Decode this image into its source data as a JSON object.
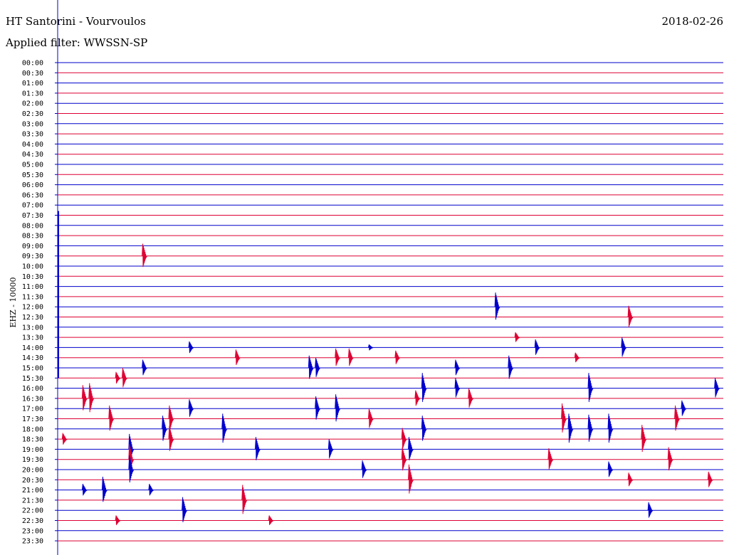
{
  "header": {
    "station": "HT Santorini - Vourvoulos",
    "date": "2018-02-26",
    "filter": "Applied filter: WWSSN-SP"
  },
  "axis": {
    "channel": "EHZ - 10000"
  },
  "colors": {
    "blue": "#0000cc",
    "red": "#dd0033",
    "axis": "#0000cc"
  },
  "chart_data": {
    "type": "line",
    "title": "HT Santorini - Vourvoulos",
    "date": "2018-02-26",
    "filter": "WWSSN-SP",
    "ylabel": "EHZ - 10000",
    "rows": [
      "00:00",
      "00:30",
      "01:00",
      "01:30",
      "02:00",
      "02:30",
      "03:00",
      "03:30",
      "04:00",
      "04:30",
      "05:00",
      "05:30",
      "06:00",
      "06:30",
      "07:00",
      "07:30",
      "08:00",
      "08:30",
      "09:00",
      "09:30",
      "10:00",
      "10:30",
      "11:00",
      "11:30",
      "12:00",
      "12:30",
      "13:00",
      "13:30",
      "14:00",
      "14:30",
      "15:00",
      "15:30",
      "16:00",
      "16:30",
      "17:00",
      "17:30",
      "18:00",
      "18:30",
      "19:00",
      "19:30",
      "20:00",
      "20:30",
      "21:00",
      "21:30",
      "22:00",
      "22:30",
      "23:00",
      "23:30"
    ],
    "events": [
      {
        "row": "09:30",
        "t": 0.13,
        "amp": 1.2
      },
      {
        "row": "12:00",
        "t": 0.66,
        "amp": 1.4
      },
      {
        "row": "12:30",
        "t": 0.86,
        "amp": 1.1
      },
      {
        "row": "13:30",
        "t": 0.69,
        "amp": 0.5
      },
      {
        "row": "14:00",
        "t": 0.2,
        "amp": 0.6
      },
      {
        "row": "14:00",
        "t": 0.47,
        "amp": 0.3
      },
      {
        "row": "14:00",
        "t": 0.72,
        "amp": 0.8
      },
      {
        "row": "14:00",
        "t": 0.85,
        "amp": 1.0
      },
      {
        "row": "14:30",
        "t": 0.27,
        "amp": 0.8
      },
      {
        "row": "14:30",
        "t": 0.42,
        "amp": 0.9
      },
      {
        "row": "14:30",
        "t": 0.44,
        "amp": 0.9
      },
      {
        "row": "14:30",
        "t": 0.51,
        "amp": 0.7
      },
      {
        "row": "14:30",
        "t": 0.78,
        "amp": 0.5
      },
      {
        "row": "15:00",
        "t": 0.13,
        "amp": 0.8
      },
      {
        "row": "15:00",
        "t": 0.38,
        "amp": 1.2
      },
      {
        "row": "15:00",
        "t": 0.39,
        "amp": 1.0
      },
      {
        "row": "15:00",
        "t": 0.6,
        "amp": 0.8
      },
      {
        "row": "15:00",
        "t": 0.68,
        "amp": 1.2
      },
      {
        "row": "15:30",
        "t": 0.09,
        "amp": 0.6
      },
      {
        "row": "15:30",
        "t": 0.1,
        "amp": 1.0
      },
      {
        "row": "16:00",
        "t": 0.55,
        "amp": 1.5
      },
      {
        "row": "16:00",
        "t": 0.6,
        "amp": 1.0
      },
      {
        "row": "16:00",
        "t": 0.8,
        "amp": 1.5
      },
      {
        "row": "16:00",
        "t": 0.99,
        "amp": 1.0
      },
      {
        "row": "16:30",
        "t": 0.04,
        "amp": 1.3
      },
      {
        "row": "16:30",
        "t": 0.05,
        "amp": 1.5
      },
      {
        "row": "16:30",
        "t": 0.54,
        "amp": 0.8
      },
      {
        "row": "16:30",
        "t": 0.62,
        "amp": 1.0
      },
      {
        "row": "17:00",
        "t": 0.2,
        "amp": 0.9
      },
      {
        "row": "17:00",
        "t": 0.39,
        "amp": 1.2
      },
      {
        "row": "17:00",
        "t": 0.42,
        "amp": 1.4
      },
      {
        "row": "17:00",
        "t": 0.94,
        "amp": 0.8
      },
      {
        "row": "17:30",
        "t": 0.08,
        "amp": 1.3
      },
      {
        "row": "17:30",
        "t": 0.17,
        "amp": 1.3
      },
      {
        "row": "17:30",
        "t": 0.47,
        "amp": 1.0
      },
      {
        "row": "17:30",
        "t": 0.76,
        "amp": 1.5
      },
      {
        "row": "17:30",
        "t": 0.93,
        "amp": 1.3
      },
      {
        "row": "18:00",
        "t": 0.16,
        "amp": 1.3
      },
      {
        "row": "18:00",
        "t": 0.25,
        "amp": 1.5
      },
      {
        "row": "18:00",
        "t": 0.55,
        "amp": 1.3
      },
      {
        "row": "18:00",
        "t": 0.77,
        "amp": 1.5
      },
      {
        "row": "18:00",
        "t": 0.8,
        "amp": 1.4
      },
      {
        "row": "18:00",
        "t": 0.83,
        "amp": 1.5
      },
      {
        "row": "18:30",
        "t": 0.01,
        "amp": 0.6
      },
      {
        "row": "18:30",
        "t": 0.17,
        "amp": 1.3
      },
      {
        "row": "18:30",
        "t": 0.52,
        "amp": 1.1
      },
      {
        "row": "18:30",
        "t": 0.88,
        "amp": 1.4
      },
      {
        "row": "19:00",
        "t": 0.11,
        "amp": 1.5
      },
      {
        "row": "19:00",
        "t": 0.3,
        "amp": 1.2
      },
      {
        "row": "19:00",
        "t": 0.41,
        "amp": 1.0
      },
      {
        "row": "19:00",
        "t": 0.53,
        "amp": 1.2
      },
      {
        "row": "19:30",
        "t": 0.11,
        "amp": 1.5
      },
      {
        "row": "19:30",
        "t": 0.52,
        "amp": 1.2
      },
      {
        "row": "19:30",
        "t": 0.74,
        "amp": 1.1
      },
      {
        "row": "19:30",
        "t": 0.92,
        "amp": 1.2
      },
      {
        "row": "20:00",
        "t": 0.11,
        "amp": 1.4
      },
      {
        "row": "20:00",
        "t": 0.46,
        "amp": 0.9
      },
      {
        "row": "20:00",
        "t": 0.83,
        "amp": 0.8
      },
      {
        "row": "20:30",
        "t": 0.53,
        "amp": 1.5
      },
      {
        "row": "20:30",
        "t": 0.86,
        "amp": 0.7
      },
      {
        "row": "20:30",
        "t": 0.98,
        "amp": 0.8
      },
      {
        "row": "21:00",
        "t": 0.04,
        "amp": 0.6
      },
      {
        "row": "21:00",
        "t": 0.07,
        "amp": 1.3
      },
      {
        "row": "21:00",
        "t": 0.14,
        "amp": 0.6
      },
      {
        "row": "21:30",
        "t": 0.28,
        "amp": 1.5
      },
      {
        "row": "22:00",
        "t": 0.19,
        "amp": 1.3
      },
      {
        "row": "22:00",
        "t": 0.89,
        "amp": 0.8
      },
      {
        "row": "22:30",
        "t": 0.09,
        "amp": 0.5
      },
      {
        "row": "22:30",
        "t": 0.32,
        "amp": 0.5
      }
    ]
  }
}
